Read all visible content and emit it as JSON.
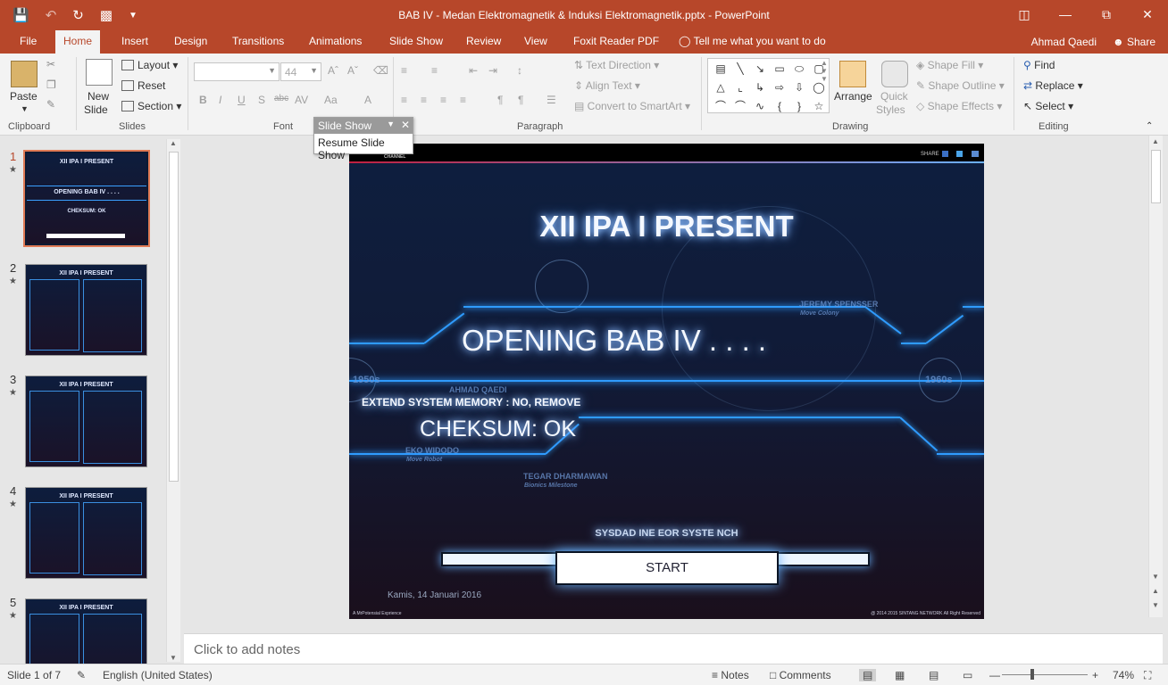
{
  "window": {
    "title": "BAB IV - Medan Elektromagnetik & Induksi Elektromagnetik.pptx - PowerPoint"
  },
  "tabs": [
    "File",
    "Home",
    "Insert",
    "Design",
    "Transitions",
    "Animations",
    "Slide Show",
    "Review",
    "View",
    "Foxit Reader PDF"
  ],
  "tell_me": "Tell me what you want to do",
  "user": "Ahmad Qaedi",
  "share": "Share",
  "ribbon": {
    "paste": "Paste",
    "new_slide_1": "New",
    "new_slide_2": "Slide",
    "layout": "Layout",
    "reset": "Reset",
    "section": "Section",
    "font_size": "44",
    "text_direction": "Text Direction",
    "align_text": "Align Text",
    "convert_smartart": "Convert to SmartArt",
    "arrange": "Arrange",
    "quick_styles_1": "Quick",
    "quick_styles_2": "Styles",
    "shape_fill": "Shape Fill",
    "shape_outline": "Shape Outline",
    "shape_effects": "Shape Effects",
    "find": "Find",
    "replace": "Replace",
    "select": "Select",
    "groups": {
      "clipboard": "Clipboard",
      "slides": "Slides",
      "font": "Font",
      "paragraph": "Paragraph",
      "drawing": "Drawing",
      "editing": "Editing"
    }
  },
  "floating_toolbar": {
    "title": "Slide Show",
    "button": "Resume Slide Show"
  },
  "thumbnails": [
    {
      "num": "1",
      "title": "XII IPA I PRESENT",
      "sub": "OPENING BAB IV . . . .",
      "extra": "CHEKSUM: OK"
    },
    {
      "num": "2",
      "title": "XII IPA I PRESENT"
    },
    {
      "num": "3",
      "title": "XII IPA I PRESENT"
    },
    {
      "num": "4",
      "title": "XII IPA I PRESENT"
    },
    {
      "num": "5",
      "title": "XII IPA I PRESENT"
    }
  ],
  "slide": {
    "channel": "CHANNEL",
    "share": "SHARE",
    "title": "XII IPA I PRESENT",
    "opening": "OPENING BAB IV . . . .",
    "memory": "EXTEND SYSTEM MEMORY : NO, REMOVE",
    "cheksum": "CHEKSUM: OK",
    "year_left": "1950s",
    "year_right": "1960s",
    "name1": "JEREMY SPENSSER",
    "name1_sub": "Move Colony",
    "name2": "AHMAD QAEDI",
    "name3": "EKO WIDODO",
    "name3_sub": "Move Robot",
    "name4": "TEGAR DHARMAWAN",
    "name4_sub": "Bionics Milestone",
    "loading": "SYSDAD INE EOR SYSTE NCH",
    "start": "START",
    "date": "Kamis, 14 Januari 2016",
    "footer_left": "A MrPotensial Exprience",
    "footer_right": "@ 2014 2015 SINTANG NETWORK All Right Reserved"
  },
  "notes_placeholder": "Click to add notes",
  "status": {
    "slide": "Slide 1 of 7",
    "language": "English (United States)",
    "notes": "Notes",
    "comments": "Comments",
    "zoom": "74%"
  }
}
